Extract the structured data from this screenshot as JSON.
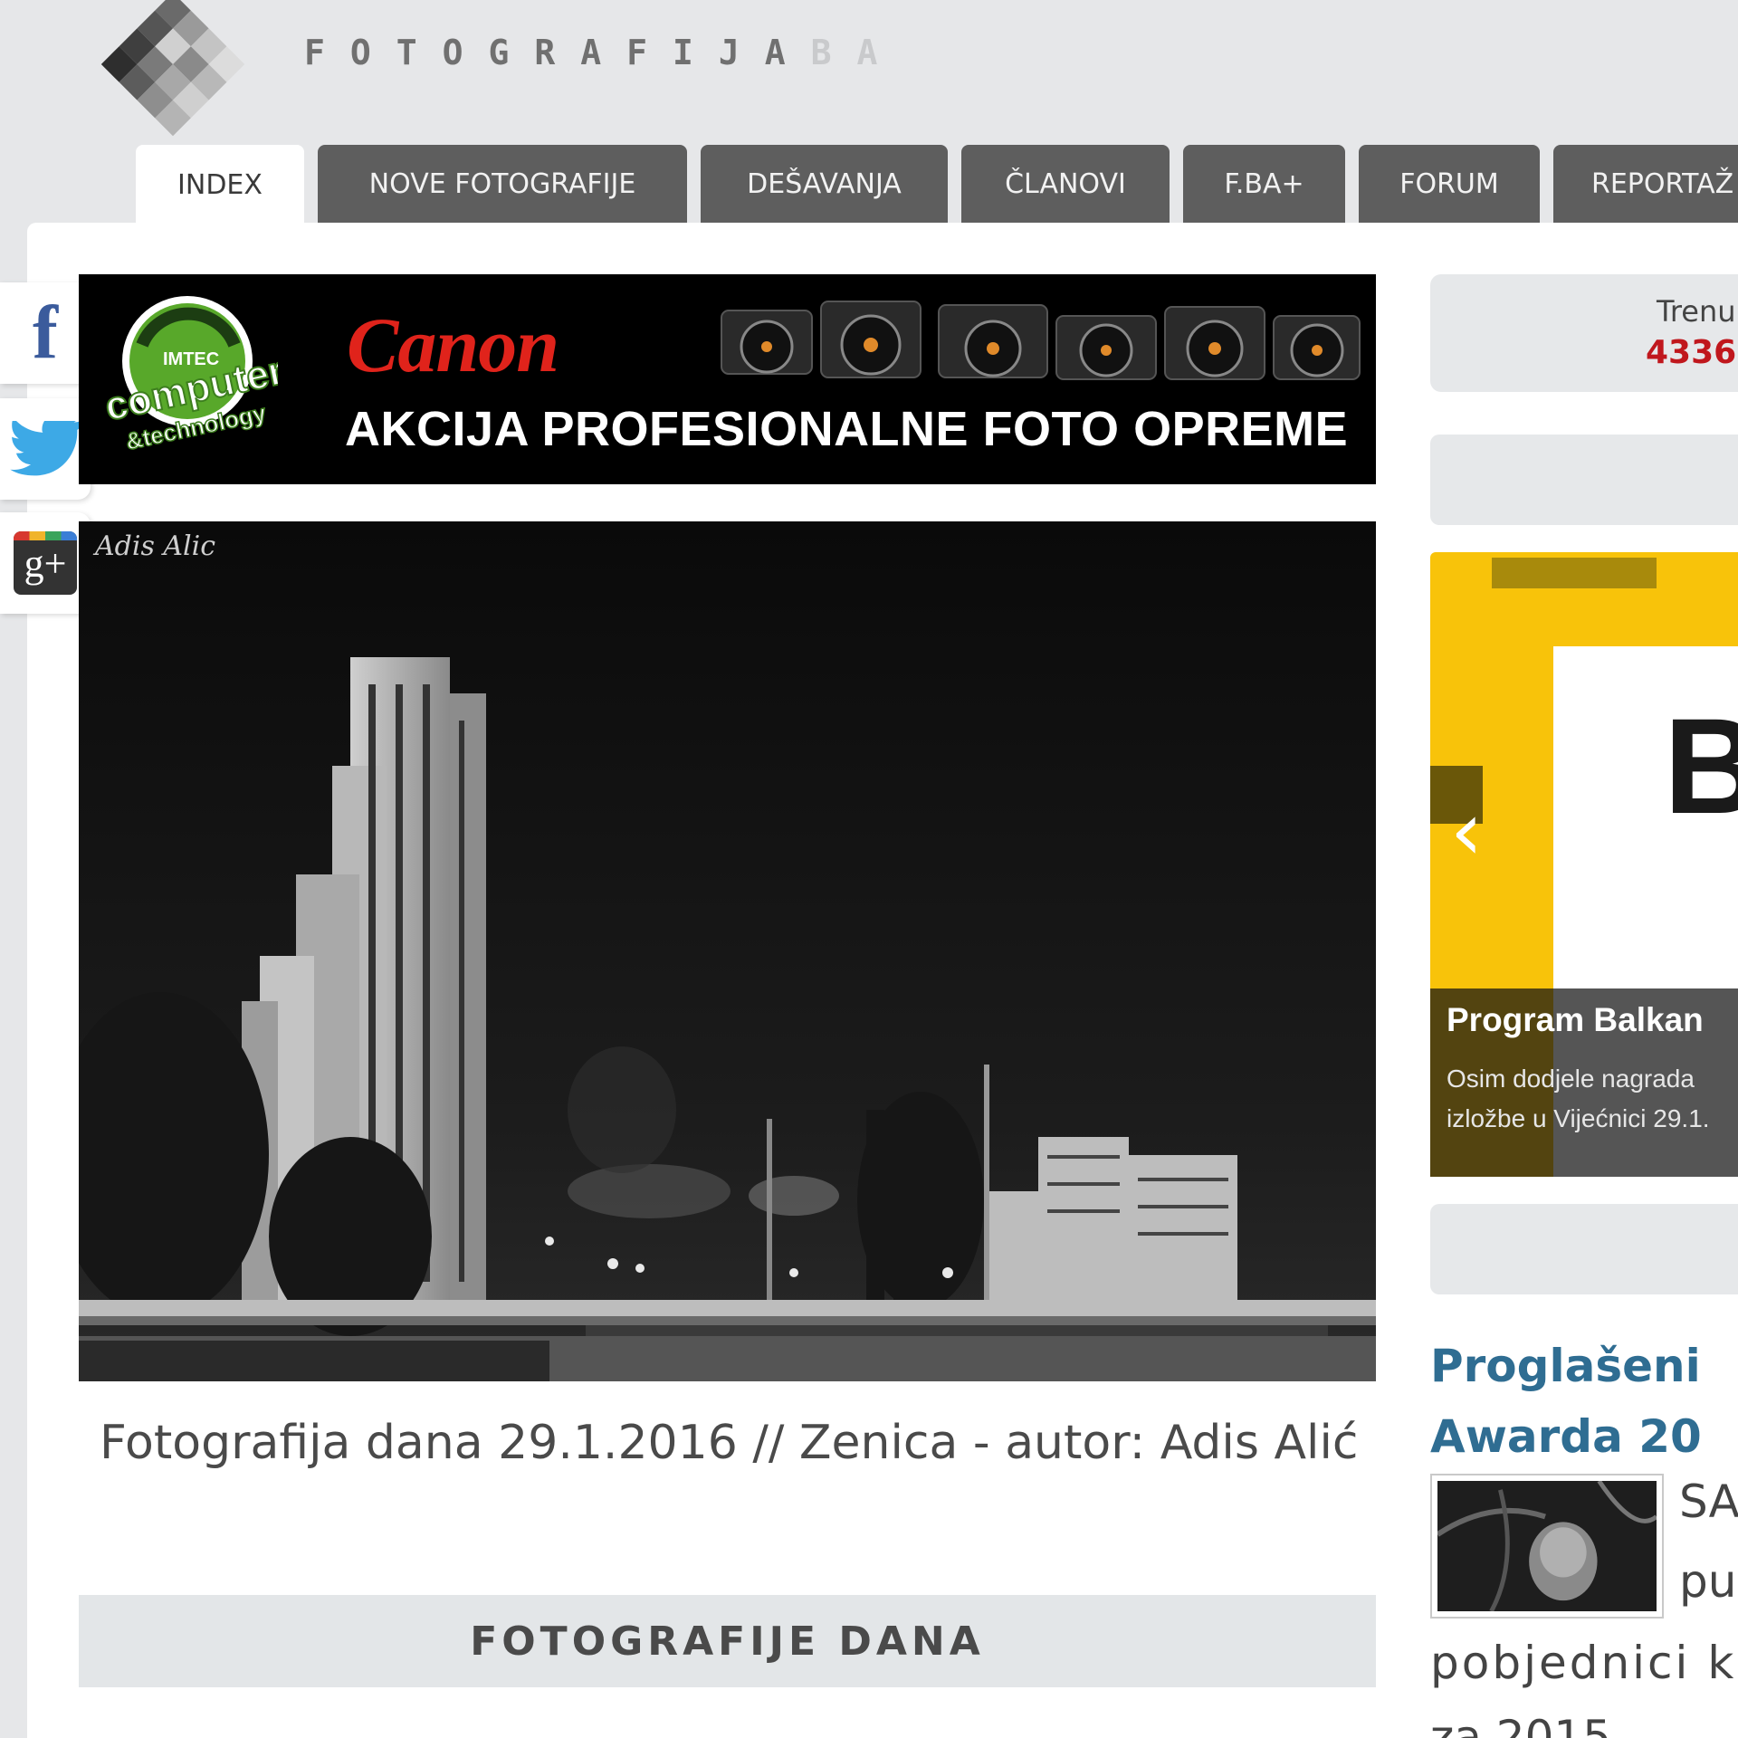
{
  "site": {
    "logo_letters": "FOTOGRAFIJA",
    "logo_suffix": "BA"
  },
  "nav": {
    "tabs": [
      {
        "label": "INDEX",
        "active": true
      },
      {
        "label": "NOVE FOTOGRAFIJE",
        "active": false
      },
      {
        "label": "DEŠAVANJA",
        "active": false
      },
      {
        "label": "ČLANOVI",
        "active": false
      },
      {
        "label": "F.BA+",
        "active": false
      },
      {
        "label": "FORUM",
        "active": false
      },
      {
        "label": "REPORTAŽ",
        "active": false
      }
    ]
  },
  "social": {
    "facebook_icon": "facebook-icon",
    "twitter_icon": "twitter-icon",
    "googleplus_icon": "google-plus-icon",
    "facebook_glyph": "f",
    "googleplus_glyph": "g+"
  },
  "banner": {
    "badge_line1": "IMTEC",
    "badge_line2": "computer",
    "badge_line3": "&technology",
    "brand": "Canon",
    "slogan": "AKCIJA PROFESIONALNE FOTO OPREME"
  },
  "photo": {
    "watermark": "Adis Alic",
    "caption": "Fotografija dana 29.1.2016 // Zenica - autor: Adis Alić"
  },
  "section": {
    "title": "FOTOGRAFIJE DANA"
  },
  "sidebar": {
    "stat_label": "Trenu",
    "stat_value": "4336",
    "slider": {
      "letter": "BA",
      "title": "Program Balkan",
      "desc_line1": "Osim dodjele nagrada",
      "desc_line2": "izložbe u Vijećnici 29.1."
    },
    "news": {
      "title_line1": "Proglašeni",
      "title_line2": "Awarda 20",
      "side_line1": "SA",
      "side_line2": "pu",
      "body_line1": "pobjednici k",
      "body_line2": "za 2015"
    }
  },
  "colors": {
    "background": "#e6e7e9",
    "nav_tab": "#5e5e5e",
    "link_blue": "#2f6d92",
    "stat_red": "#c0171d",
    "slider_yellow": "#f8c30a",
    "canon_red": "#e0231b"
  }
}
